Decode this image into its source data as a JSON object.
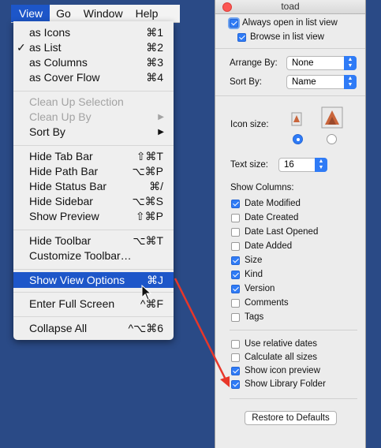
{
  "menubar": {
    "items": [
      "View",
      "Go",
      "Window",
      "Help"
    ]
  },
  "menu": {
    "items": [
      {
        "label": "as Icons",
        "shortcut": "⌘1"
      },
      {
        "label": "as List",
        "shortcut": "⌘2",
        "checked": true,
        "check": "✓"
      },
      {
        "label": "as Columns",
        "shortcut": "⌘3"
      },
      {
        "label": "as Cover Flow",
        "shortcut": "⌘4"
      },
      {
        "label": "Clean Up Selection",
        "shortcut": "",
        "disabled": true
      },
      {
        "label": "Clean Up By",
        "shortcut": "",
        "disabled": true,
        "submenu": "▶"
      },
      {
        "label": "Sort By",
        "shortcut": "",
        "submenu": "▶"
      },
      {
        "label": "Hide Tab Bar",
        "shortcut": "⇧⌘T"
      },
      {
        "label": "Hide Path Bar",
        "shortcut": "⌥⌘P"
      },
      {
        "label": "Hide Status Bar",
        "shortcut": "⌘/"
      },
      {
        "label": "Hide Sidebar",
        "shortcut": "⌥⌘S"
      },
      {
        "label": "Show Preview",
        "shortcut": "⇧⌘P"
      },
      {
        "label": "Hide Toolbar",
        "shortcut": "⌥⌘T"
      },
      {
        "label": "Customize Toolbar…",
        "shortcut": ""
      },
      {
        "label": "Show View Options",
        "shortcut": "⌘J",
        "selected": true
      },
      {
        "label": "Enter Full Screen",
        "shortcut": "^⌘F"
      },
      {
        "label": "Collapse All",
        "shortcut": "^⌥⌘6"
      }
    ]
  },
  "panel": {
    "title": "toad",
    "always_open": {
      "label": "Always open in list view",
      "checked": true
    },
    "browse_list": {
      "label": "Browse in list view",
      "checked": true
    },
    "arrange_by": {
      "label": "Arrange By:",
      "value": "None"
    },
    "sort_by": {
      "label": "Sort By:",
      "value": "Name"
    },
    "icon_size": {
      "label": "Icon size:",
      "selected": "small"
    },
    "text_size": {
      "label": "Text size:",
      "value": "16"
    },
    "show_columns_label": "Show Columns:",
    "columns": [
      {
        "label": "Date Modified",
        "checked": true
      },
      {
        "label": "Date Created",
        "checked": false
      },
      {
        "label": "Date Last Opened",
        "checked": false
      },
      {
        "label": "Date Added",
        "checked": false
      },
      {
        "label": "Size",
        "checked": true
      },
      {
        "label": "Kind",
        "checked": true
      },
      {
        "label": "Version",
        "checked": true
      },
      {
        "label": "Comments",
        "checked": false
      },
      {
        "label": "Tags",
        "checked": false
      }
    ],
    "options": [
      {
        "label": "Use relative dates",
        "checked": false
      },
      {
        "label": "Calculate all sizes",
        "checked": false
      },
      {
        "label": "Show icon preview",
        "checked": true
      },
      {
        "label": "Show Library Folder",
        "checked": true
      }
    ],
    "restore_button": "Restore to Defaults"
  },
  "colors": {
    "desktop": "#2a4a86",
    "menu_highlight": "#1d56c9",
    "accent": "#2f7bf6",
    "annotation_arrow": "#e8372a"
  }
}
